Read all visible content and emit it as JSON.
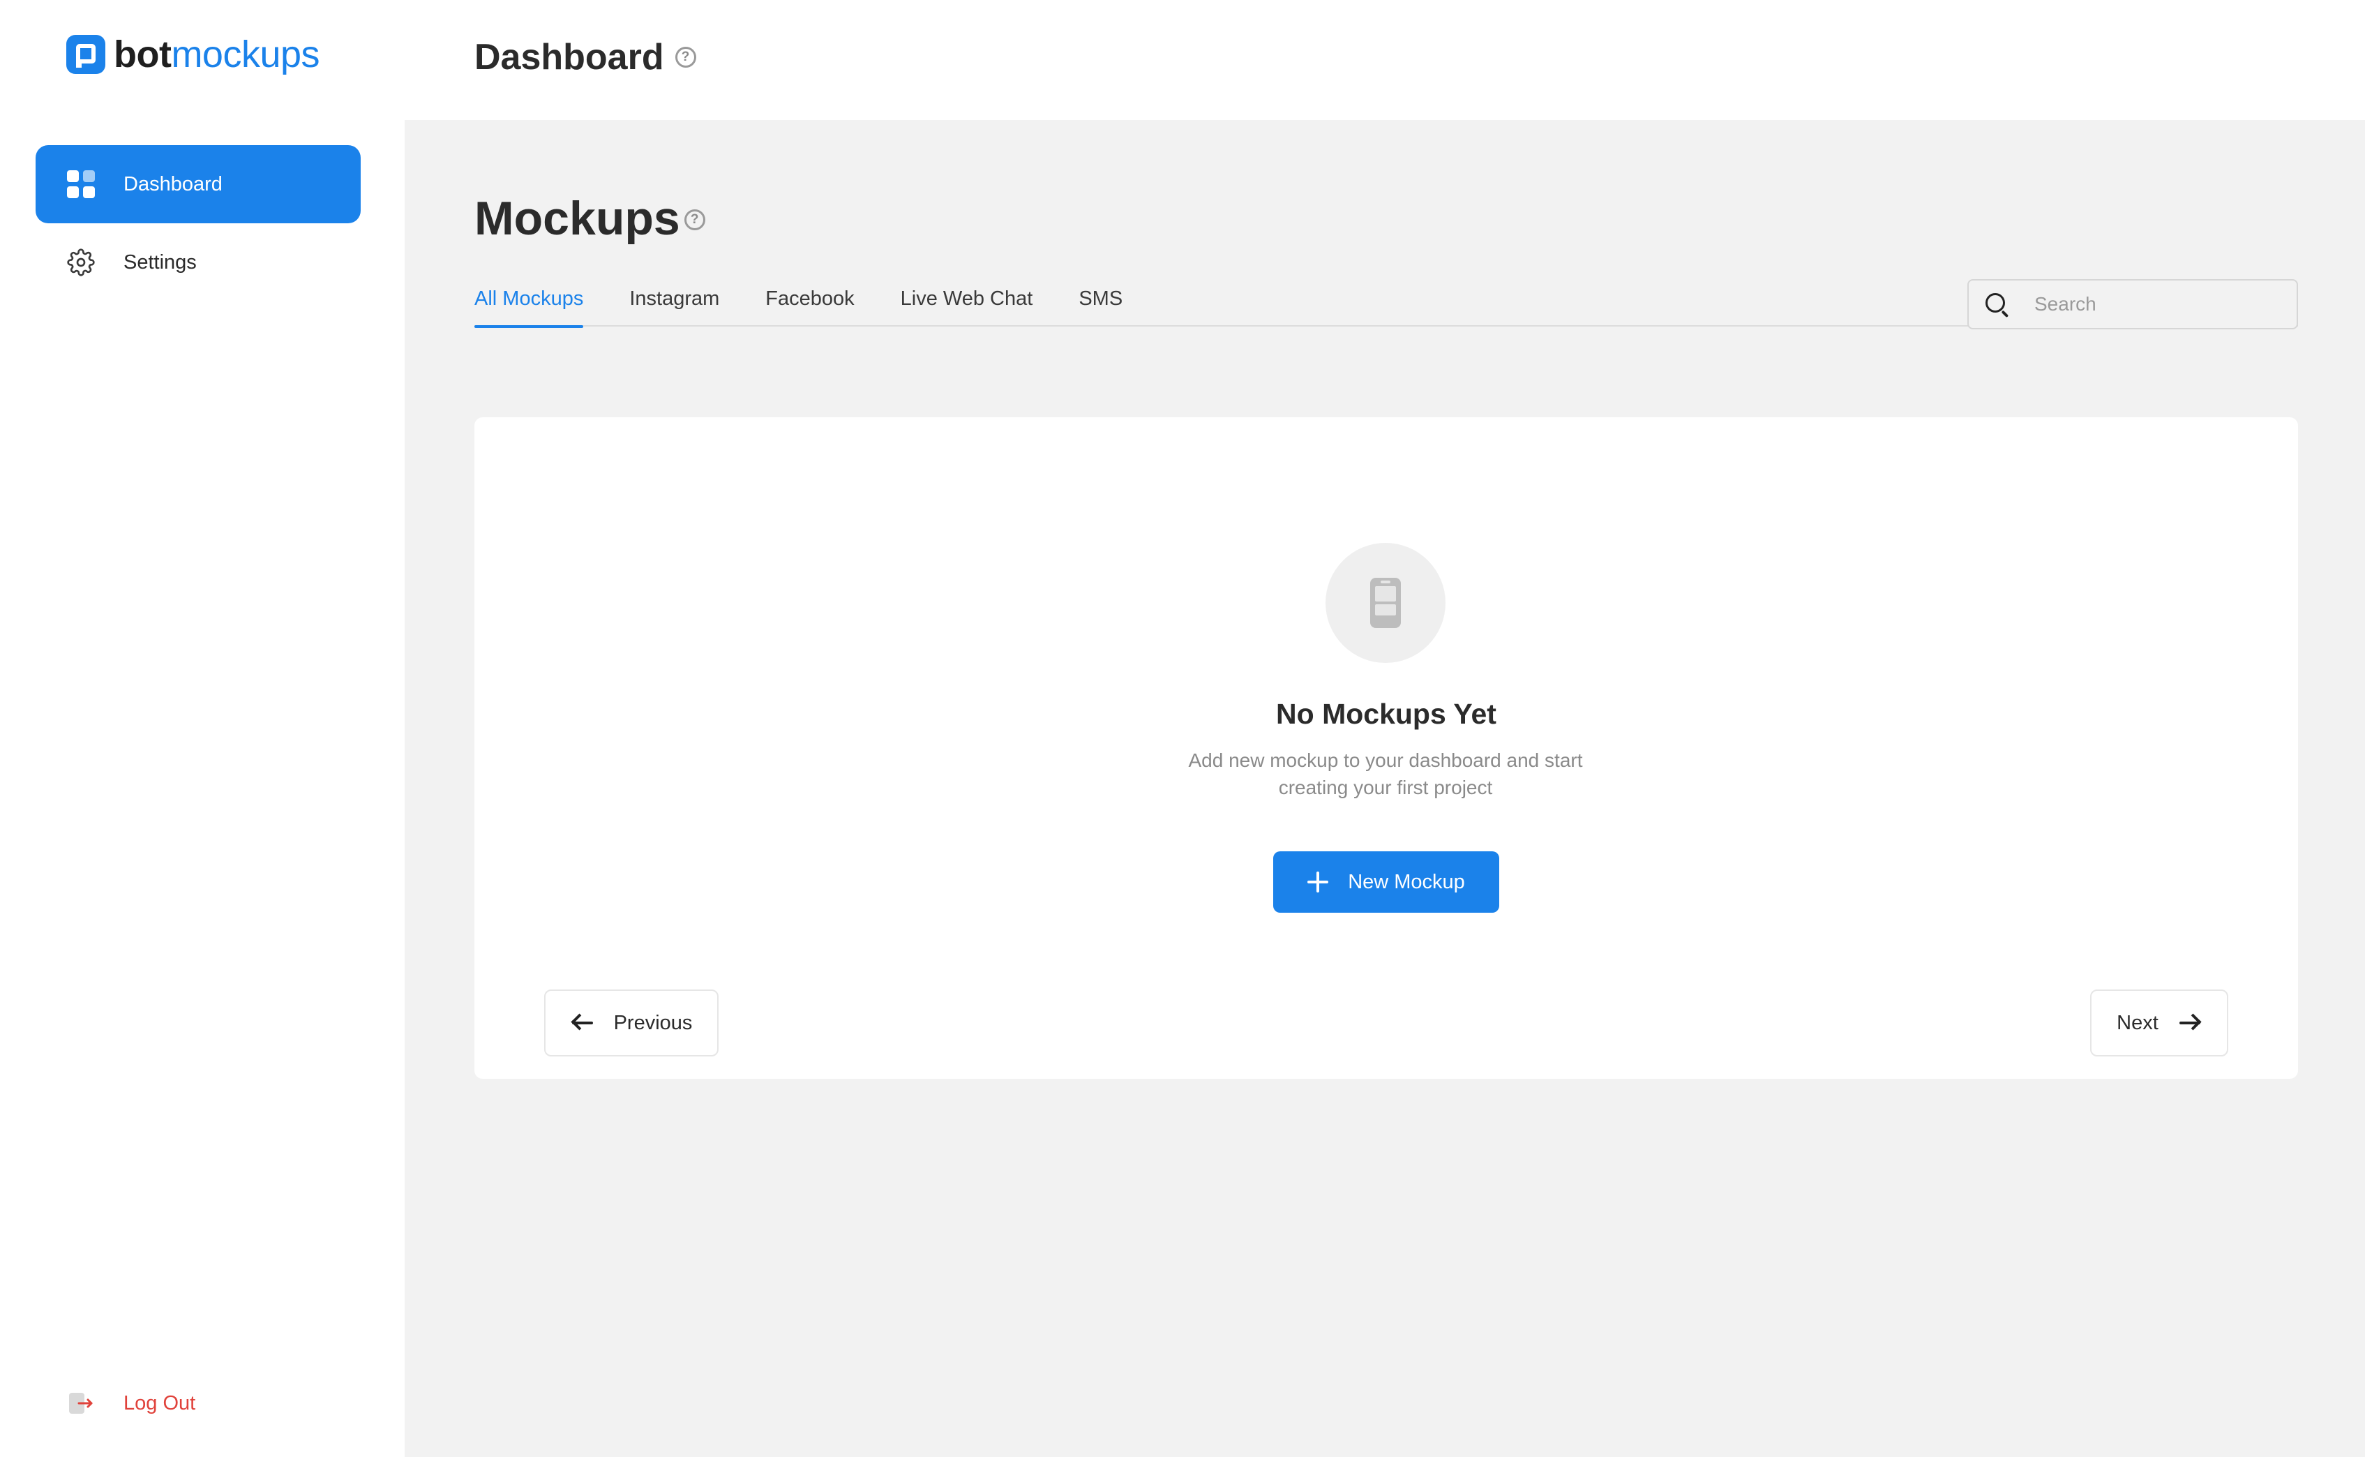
{
  "brand": {
    "part_bold": "bot",
    "part_light": "mockups",
    "accent_color": "#1b82ea"
  },
  "sidebar": {
    "items": [
      {
        "label": "Dashboard",
        "icon": "grid-icon",
        "active": true
      },
      {
        "label": "Settings",
        "icon": "gear-icon",
        "active": false
      }
    ],
    "logout_label": "Log Out",
    "logout_icon": "logout-icon",
    "logout_color": "#e0423b"
  },
  "header": {
    "title": "Dashboard",
    "help_glyph": "?"
  },
  "main": {
    "section_title": "Mockups",
    "help_glyph": "?",
    "tabs": [
      {
        "label": "All Mockups",
        "active": true
      },
      {
        "label": "Instagram",
        "active": false
      },
      {
        "label": "Facebook",
        "active": false
      },
      {
        "label": "Live Web Chat",
        "active": false
      },
      {
        "label": "SMS",
        "active": false
      }
    ],
    "search": {
      "placeholder": "Search",
      "value": "",
      "icon": "search-icon"
    },
    "empty_state": {
      "icon": "phone-icon",
      "title": "No Mockups Yet",
      "description": "Add new mockup to your dashboard and start creating your first project",
      "button_label": "New Mockup"
    },
    "pagination": {
      "previous_label": "Previous",
      "next_label": "Next"
    }
  }
}
